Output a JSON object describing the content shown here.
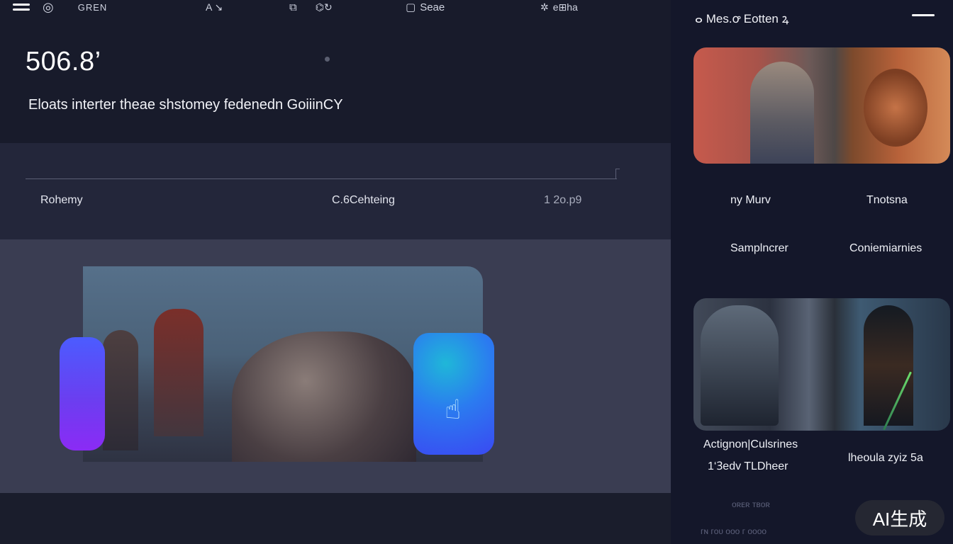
{
  "topbar": {
    "brand": "GREN",
    "item2": "A ↘",
    "item3": "⌬↻",
    "item4": "Seae",
    "item5": "e⊞ha"
  },
  "hero": {
    "value": "506.8’",
    "subtitle": "Eloats interter theae shstomey fedenedn  GoiiinCY"
  },
  "columns": {
    "col1": "Rohemy",
    "col2": "C.6Cehteing",
    "col3": "1 2o.p9"
  },
  "sidebar": {
    "title": "ⴰ Mes.ꝍ Eotten ꝝ",
    "labels": {
      "a": "ny Murv",
      "b": "Tnotsna",
      "c": "Samplncrer",
      "d": "Coniemiarnies",
      "e": "Actignon|Culsrines",
      "f": "1‘Ꝫedv TLDheer",
      "g": "lheoula zyiz  5a"
    },
    "faint": {
      "f1": "ᴏʀᴇʀ ᴛʙᴏʀ",
      "f2": "ᴦɴ ᴦᴏᴜ  ᴏᴏᴏ ᴦ ᴏᴏᴏᴏ"
    }
  },
  "watermark": "AI生成",
  "colors": {
    "bg": "#151826",
    "panel": "#23263a",
    "media_panel": "#3a3d52",
    "accent_blue": "#3a49f2",
    "accent_purple": "#8b2bf5"
  }
}
